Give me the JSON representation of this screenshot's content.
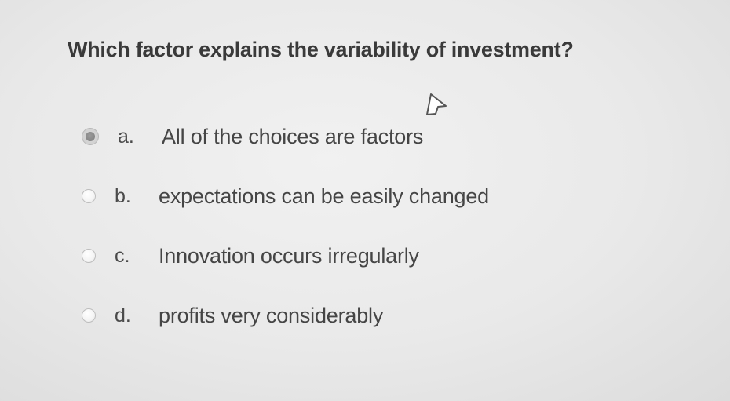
{
  "question": {
    "text": "Which factor explains the variability of investment?"
  },
  "options": [
    {
      "letter": "a.",
      "text": "All of the choices are factors",
      "selected": true
    },
    {
      "letter": "b.",
      "text": "expectations can be easily changed",
      "selected": false
    },
    {
      "letter": "c.",
      "text": "Innovation occurs irregularly",
      "selected": false
    },
    {
      "letter": "d.",
      "text": "profits very considerably",
      "selected": false
    }
  ],
  "cursor": {
    "icon": "mouse-pointer-icon"
  },
  "colors": {
    "background": "#e9e9e9",
    "text": "#454545",
    "radio_selected": "#8a8a8a"
  }
}
